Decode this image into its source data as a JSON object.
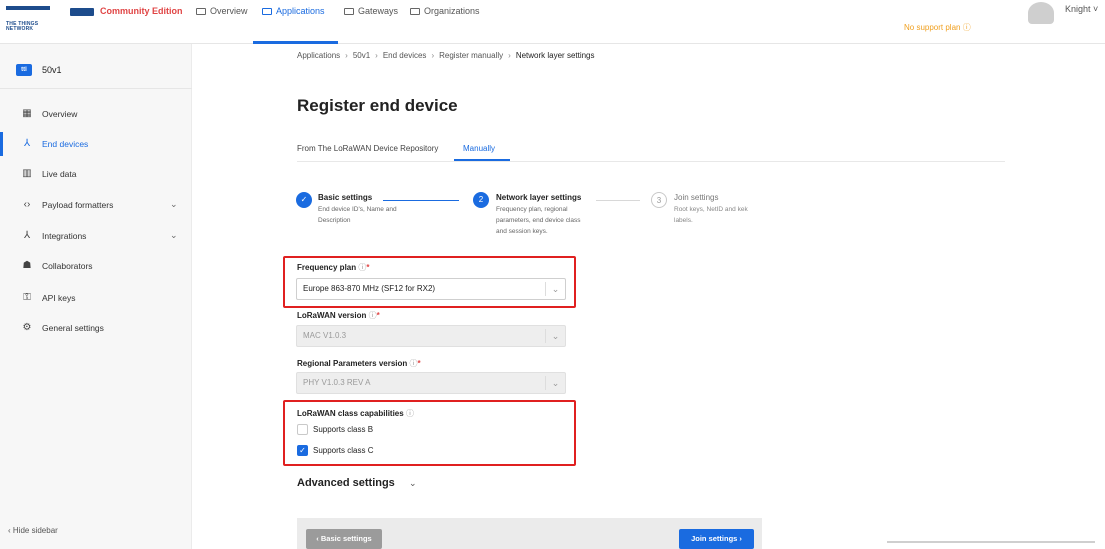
{
  "brand": {
    "logo_text": "THE THINGS NETWORK",
    "edition": "Community Edition"
  },
  "top_nav": {
    "items": [
      {
        "label": "Overview",
        "icon": "grid-icon"
      },
      {
        "label": "Applications",
        "icon": "folder-icon",
        "active": true
      },
      {
        "label": "Gateways",
        "icon": "gateway-icon"
      },
      {
        "label": "Organizations",
        "icon": "organization-icon"
      }
    ],
    "support": "No support plan ⓘ",
    "user": "Knight"
  },
  "sidebar": {
    "app_badge": "ttl",
    "app_name": "50v1",
    "items": [
      {
        "label": "Overview",
        "icon": "overview-icon"
      },
      {
        "label": "End devices",
        "icon": "end-devices-icon",
        "active": true
      },
      {
        "label": "Live data",
        "icon": "live-data-icon"
      },
      {
        "label": "Payload formatters",
        "icon": "code-icon",
        "expandable": true
      },
      {
        "label": "Integrations",
        "icon": "integrations-icon",
        "expandable": true
      },
      {
        "label": "Collaborators",
        "icon": "collaborators-icon"
      },
      {
        "label": "API keys",
        "icon": "key-icon"
      },
      {
        "label": "General settings",
        "icon": "gear-icon"
      }
    ],
    "hide_label": "‹  Hide sidebar"
  },
  "breadcrumb": [
    "Applications",
    "50v1",
    "End devices",
    "Register manually",
    "Network layer settings"
  ],
  "page_title": "Register end device",
  "tabs": [
    "From The LoRaWAN Device Repository",
    "Manually"
  ],
  "stepper": [
    {
      "number": "✓",
      "title": "Basic settings",
      "desc": "End device ID's, Name and Description",
      "state": "done"
    },
    {
      "number": "2",
      "title": "Network layer settings",
      "desc": "Frequency plan, regional parameters, end device class and session keys.",
      "state": "active"
    },
    {
      "number": "3",
      "title": "Join settings",
      "desc": "Root keys, NetID and kek labels.",
      "state": "pending"
    }
  ],
  "fields": {
    "frequency_plan": {
      "label": "Frequency plan",
      "value": "Europe 863-870 MHz (SF12 for RX2)"
    },
    "lorawan_version": {
      "label": "LoRaWAN version",
      "value": "MAC V1.0.3"
    },
    "regional_params": {
      "label": "Regional Parameters version",
      "value": "PHY V1.0.3 REV A"
    },
    "class_caps": {
      "label": "LoRaWAN class capabilities",
      "options": [
        {
          "label": "Supports class B",
          "checked": false
        },
        {
          "label": "Supports class C",
          "checked": true
        }
      ]
    }
  },
  "advanced_label": "Advanced settings",
  "buttons": {
    "back": "‹  Basic settings",
    "next": "Join settings  ›"
  },
  "colors": {
    "accent": "#1a6be0",
    "highlight_box": "#e02020",
    "edition": "#e04545",
    "support": "#f0a020"
  }
}
